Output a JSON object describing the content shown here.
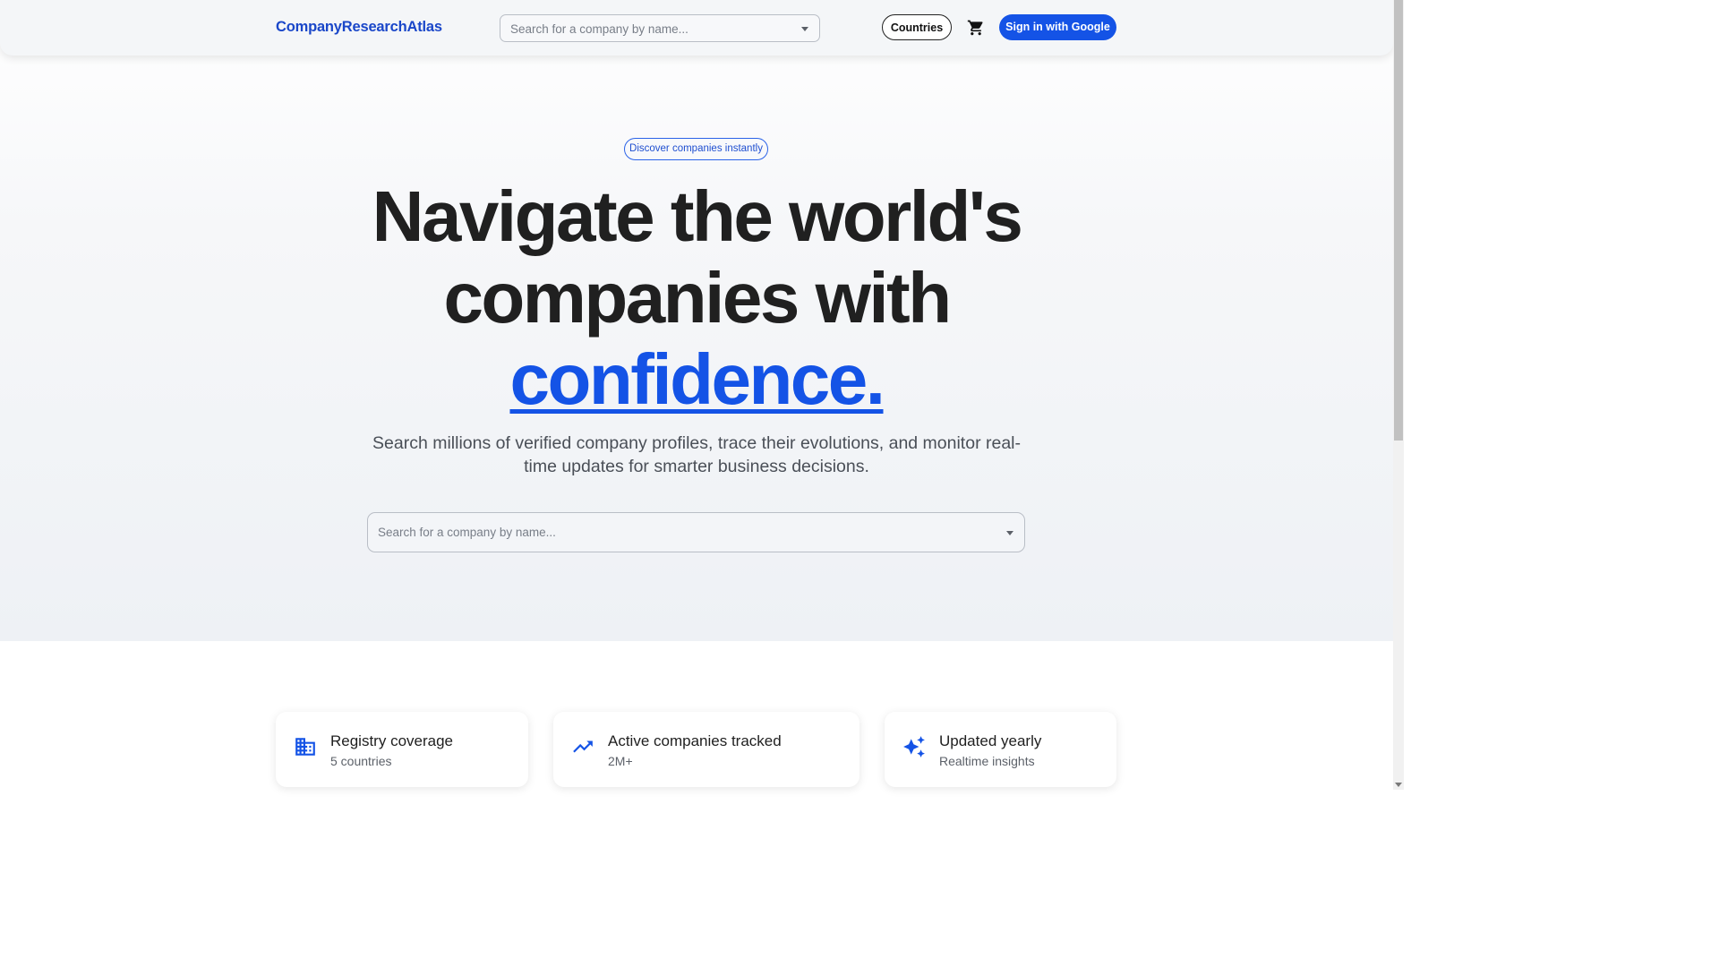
{
  "header": {
    "logo": "CompanyResearchAtlas",
    "search_placeholder": "Search for a company by name...",
    "countries_label": "Countries",
    "cart_icon": "cart-icon",
    "signin_label": "Sign in with Google"
  },
  "hero": {
    "pill": "Discover companies instantly",
    "headline_line1": "Navigate the world's",
    "headline_line2": "companies with",
    "headline_accent": "confidence.",
    "subtitle": "Search millions of verified company profiles, trace their evolutions, and monitor real-time updates for smarter business decisions.",
    "search_placeholder": "Search for a company by name..."
  },
  "stats": [
    {
      "icon": "building-icon",
      "title": "Registry coverage",
      "value": "5 countries"
    },
    {
      "icon": "trending-up-icon",
      "title": "Active companies tracked",
      "value": "2M+"
    },
    {
      "icon": "sparkles-icon",
      "title": "Updated yearly",
      "value": "Realtime insights"
    }
  ],
  "colors": {
    "accent": "#1453e6",
    "logo": "#1a47c9",
    "text": "#202020"
  }
}
